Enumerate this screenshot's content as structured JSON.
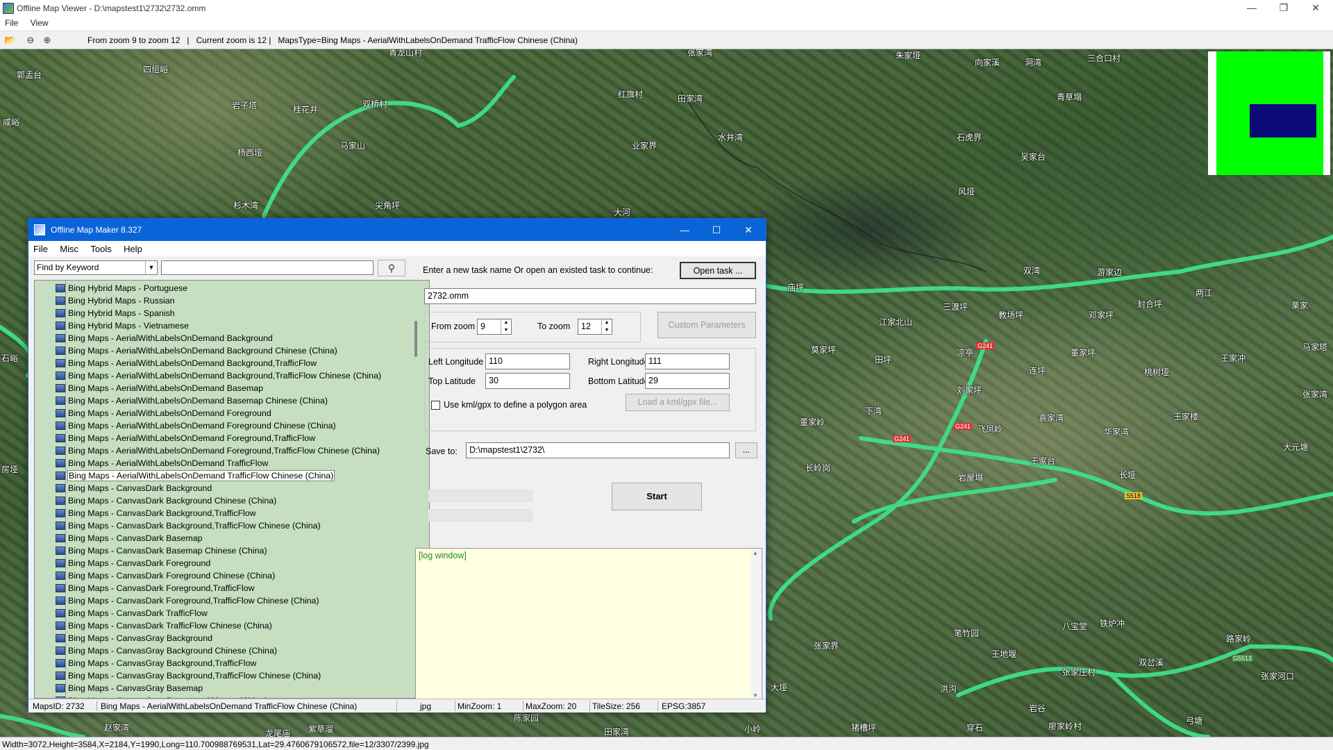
{
  "viewer": {
    "title": "Offline Map Viewer - D:\\mapstest1\\2732\\2732.omm",
    "menu": [
      "File",
      "View"
    ],
    "toolbar_info": "From zoom 9 to zoom 12   |   Current zoom is 12 |   MapsType=Bing Maps - AerialWithLabelsOnDemand TrafficFlow Chinese (China)",
    "status": "Width=3072,Height=3584,X=2184,Y=1990,Long=110.700988769531,Lat=29.4760679106572,file=12/3307/2399.jpg",
    "icons": [
      "folder-open-icon",
      "zoom-out-icon",
      "zoom-in-icon"
    ]
  },
  "map": {
    "places": [
      {
        "name": "郭孟台"
      },
      {
        "name": "四组峪"
      },
      {
        "name": "青龙山村"
      },
      {
        "name": "张家湾"
      },
      {
        "name": "朱家垭"
      },
      {
        "name": "向家溪"
      },
      {
        "name": "洞湾"
      },
      {
        "name": "三合口村"
      },
      {
        "name": "咸峪"
      },
      {
        "name": "岩子塔"
      },
      {
        "name": "桂花井"
      },
      {
        "name": "双桥村"
      },
      {
        "name": "红旗村"
      },
      {
        "name": "田家湾"
      },
      {
        "name": "青草塌"
      },
      {
        "name": "杨西垭"
      },
      {
        "name": "马家山"
      },
      {
        "name": "业家界"
      },
      {
        "name": "水井湾"
      },
      {
        "name": "石虎界"
      },
      {
        "name": "吴家台"
      },
      {
        "name": "杉木湾"
      },
      {
        "name": "尖角坪"
      },
      {
        "name": "大河"
      },
      {
        "name": "风垭"
      },
      {
        "name": "庙坪"
      },
      {
        "name": "双湾"
      },
      {
        "name": "游家边"
      },
      {
        "name": "三渡坪"
      },
      {
        "name": "教场坪"
      },
      {
        "name": "邓家坪"
      },
      {
        "name": "封合坪"
      },
      {
        "name": "两江"
      },
      {
        "name": "栗家"
      },
      {
        "name": "江家北山"
      },
      {
        "name": "凉亭"
      },
      {
        "name": "田坪"
      },
      {
        "name": "莫家坪"
      },
      {
        "name": "董家坪"
      },
      {
        "name": "马家塔"
      },
      {
        "name": "王家冲"
      },
      {
        "name": "连坪"
      },
      {
        "name": "桃树垭"
      },
      {
        "name": "刘家坪"
      },
      {
        "name": "张家湾"
      },
      {
        "name": "下湾"
      },
      {
        "name": "飞凤岭"
      },
      {
        "name": "袁家湾"
      },
      {
        "name": "王家楼"
      },
      {
        "name": "董家岭"
      },
      {
        "name": "华家湾"
      },
      {
        "name": "大元塘"
      },
      {
        "name": "王家台"
      },
      {
        "name": "长岭岗"
      },
      {
        "name": "岩屋塌"
      },
      {
        "name": "长垭"
      },
      {
        "name": "张家界"
      },
      {
        "name": "笔竹园"
      },
      {
        "name": "八宝堂"
      },
      {
        "name": "铁炉冲"
      },
      {
        "name": "路家岭"
      },
      {
        "name": "王地堰"
      },
      {
        "name": "张家庄村"
      },
      {
        "name": "双岔溪"
      },
      {
        "name": "张家河口"
      },
      {
        "name": "大垭"
      },
      {
        "name": "洪沟"
      },
      {
        "name": "岩谷"
      },
      {
        "name": "弓塘"
      },
      {
        "name": "赵家湾"
      },
      {
        "name": "田家湾"
      },
      {
        "name": "紫草溜"
      },
      {
        "name": "陈家园"
      },
      {
        "name": "小岭"
      },
      {
        "name": "猪槽坪"
      },
      {
        "name": "穿石"
      },
      {
        "name": "廖家岭村"
      },
      {
        "name": "龙尾庙"
      },
      {
        "name": "房垭"
      },
      {
        "name": "石峪"
      }
    ],
    "road_labels": [
      "G241",
      "G241",
      "G241",
      "S518",
      "G5513"
    ]
  },
  "dialog": {
    "title": "Offline Map Maker 8.327",
    "menu": [
      "File",
      "Misc",
      "Tools",
      "Help"
    ],
    "find_mode": "Find by Keyword",
    "find_value": "",
    "map_list": [
      "Bing Hybrid Maps - Portuguese",
      "Bing Hybrid Maps - Russian",
      "Bing Hybrid Maps - Spanish",
      "Bing Hybrid Maps - Vietnamese",
      "Bing Maps - AerialWithLabelsOnDemand Background",
      "Bing Maps - AerialWithLabelsOnDemand Background Chinese (China)",
      "Bing Maps - AerialWithLabelsOnDemand Background,TrafficFlow",
      "Bing Maps - AerialWithLabelsOnDemand Background,TrafficFlow Chinese (China)",
      "Bing Maps - AerialWithLabelsOnDemand Basemap",
      "Bing Maps - AerialWithLabelsOnDemand Basemap Chinese (China)",
      "Bing Maps - AerialWithLabelsOnDemand Foreground",
      "Bing Maps - AerialWithLabelsOnDemand Foreground Chinese (China)",
      "Bing Maps - AerialWithLabelsOnDemand Foreground,TrafficFlow",
      "Bing Maps - AerialWithLabelsOnDemand Foreground,TrafficFlow Chinese (China)",
      "Bing Maps - AerialWithLabelsOnDemand TrafficFlow",
      "Bing Maps - AerialWithLabelsOnDemand TrafficFlow Chinese (China)",
      "Bing Maps - CanvasDark Background",
      "Bing Maps - CanvasDark Background Chinese (China)",
      "Bing Maps - CanvasDark Background,TrafficFlow",
      "Bing Maps - CanvasDark Background,TrafficFlow Chinese (China)",
      "Bing Maps - CanvasDark Basemap",
      "Bing Maps - CanvasDark Basemap Chinese (China)",
      "Bing Maps - CanvasDark Foreground",
      "Bing Maps - CanvasDark Foreground Chinese (China)",
      "Bing Maps - CanvasDark Foreground,TrafficFlow",
      "Bing Maps - CanvasDark Foreground,TrafficFlow Chinese (China)",
      "Bing Maps - CanvasDark TrafficFlow",
      "Bing Maps - CanvasDark TrafficFlow Chinese (China)",
      "Bing Maps - CanvasGray Background",
      "Bing Maps - CanvasGray Background Chinese (China)",
      "Bing Maps - CanvasGray Background,TrafficFlow",
      "Bing Maps - CanvasGray Background,TrafficFlow Chinese (China)",
      "Bing Maps - CanvasGray Basemap",
      "Bing Maps - CanvasGray Basemap Chinese (China)"
    ],
    "selected_index": 15,
    "task_prompt": "Enter a new task name Or open an existed task to continue:",
    "open_task_label": "Open task ...",
    "task_name": "2732.omm",
    "from_zoom_label": "From zoom",
    "from_zoom": "9",
    "to_zoom_label": "To zoom",
    "to_zoom": "12",
    "custom_params_label": "Custom Parameters",
    "left_lon_label": "Left Longitude",
    "left_lon": "110",
    "right_lon_label": "Right Longitude",
    "right_lon": "111",
    "top_lat_label": "Top Latitude",
    "top_lat": "30",
    "bottom_lat_label": "Bottom Latitude",
    "bottom_lat": "29",
    "kml_label": "Use kml/gpx to define a polygon area",
    "load_kml_label": "Load a kml/gpx file...",
    "save_to_label": "Save to:",
    "save_to": "D:\\mapstest1\\2732\\",
    "browse_label": "...",
    "start_label": "Start",
    "log_text": "[log window]",
    "status": {
      "maps_id": "MapsID: 2732",
      "maps_name": "Bing Maps - AerialWithLabelsOnDemand TrafficFlow Chinese (China)",
      "format": "jpg",
      "min_zoom": "MinZoom: 1",
      "max_zoom": "MaxZoom: 20",
      "tile_size": "TileSize: 256",
      "epsg": "EPSG:3857"
    }
  }
}
